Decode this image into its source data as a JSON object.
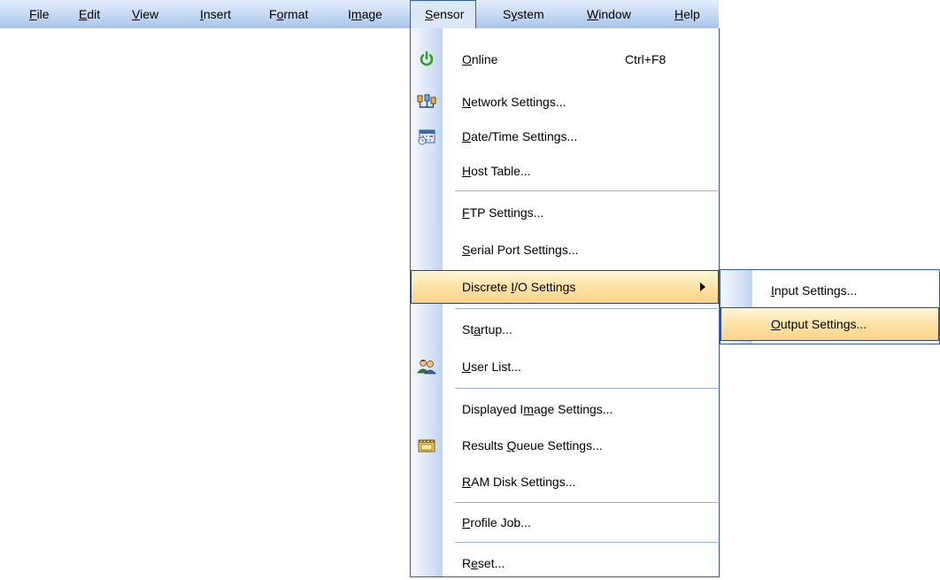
{
  "menubar": {
    "items": [
      {
        "pre": "",
        "ul": "F",
        "post": "ile"
      },
      {
        "pre": "",
        "ul": "E",
        "post": "dit"
      },
      {
        "pre": "",
        "ul": "V",
        "post": "iew"
      },
      {
        "pre": "",
        "ul": "I",
        "post": "nsert"
      },
      {
        "pre": "F",
        "ul": "o",
        "post": "rmat"
      },
      {
        "pre": "I",
        "ul": "m",
        "post": "age"
      },
      {
        "pre": "",
        "ul": "S",
        "post": "ensor"
      },
      {
        "pre": "S",
        "ul": "y",
        "post": "stem"
      },
      {
        "pre": "",
        "ul": "W",
        "post": "indow"
      },
      {
        "pre": "",
        "ul": "H",
        "post": "elp"
      }
    ]
  },
  "sensor_menu": {
    "items": [
      {
        "pre": "",
        "ul": "O",
        "post": "nline",
        "shortcut": "Ctrl+F8",
        "icon": "power-icon"
      },
      {
        "pre": "",
        "ul": "N",
        "post": "etwork Settings...",
        "icon": "network-icon"
      },
      {
        "pre": "",
        "ul": "D",
        "post": "ate/Time Settings...",
        "icon": "calendar-clock-icon"
      },
      {
        "pre": "",
        "ul": "H",
        "post": "ost Table..."
      },
      {
        "pre": "",
        "ul": "F",
        "post": "TP Settings..."
      },
      {
        "pre": "",
        "ul": "S",
        "post": "erial Port Settings..."
      },
      {
        "pre": "Discrete ",
        "ul": "I",
        "post": "/O Settings"
      },
      {
        "pre": "St",
        "ul": "a",
        "post": "rtup..."
      },
      {
        "pre": "",
        "ul": "U",
        "post": "ser List...",
        "icon": "users-icon"
      },
      {
        "pre": "Displayed I",
        "ul": "m",
        "post": "age Settings..."
      },
      {
        "pre": "Results ",
        "ul": "Q",
        "post": "ueue Settings...",
        "icon": "film-icon"
      },
      {
        "pre": "",
        "ul": "R",
        "post": "AM Disk Settings..."
      },
      {
        "pre": "",
        "ul": "P",
        "post": "rofile Job..."
      },
      {
        "pre": "R",
        "ul": "e",
        "post": "set..."
      }
    ]
  },
  "submenu": {
    "items": [
      {
        "pre": "",
        "ul": "I",
        "post": "nput Settings..."
      },
      {
        "pre": "",
        "ul": "O",
        "post": "utput Settings..."
      }
    ]
  }
}
